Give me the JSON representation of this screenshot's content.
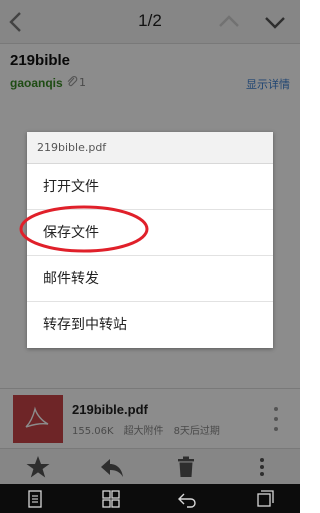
{
  "nav": {
    "page_indicator": "1/2"
  },
  "mail": {
    "subject": "219bible",
    "sender": "gaoanqis",
    "attachment_count": "1",
    "details_link": "显示详情"
  },
  "dialog": {
    "title": "219bible.pdf",
    "items": [
      {
        "label": "打开文件"
      },
      {
        "label": "保存文件"
      },
      {
        "label": "邮件转发"
      },
      {
        "label": "转存到中转站"
      }
    ]
  },
  "attachment": {
    "name": "219bible.pdf",
    "size": "155.06K",
    "type_label": "超大附件",
    "expiry": "8天后过期"
  },
  "colors": {
    "sender": "#3a8a26",
    "link": "#3a7ed0",
    "pdf_thumb": "#c94448",
    "highlight_ring": "#e0202a"
  },
  "icons": {
    "back": "chevron-left-icon",
    "prev": "chevron-up-icon",
    "next": "chevron-down-icon",
    "attachment": "paperclip-icon",
    "pdf": "pdf-icon",
    "more": "more-vertical-icon",
    "star": "star-icon",
    "reply": "reply-icon",
    "delete": "trash-icon",
    "menu": "more-vertical-icon"
  }
}
